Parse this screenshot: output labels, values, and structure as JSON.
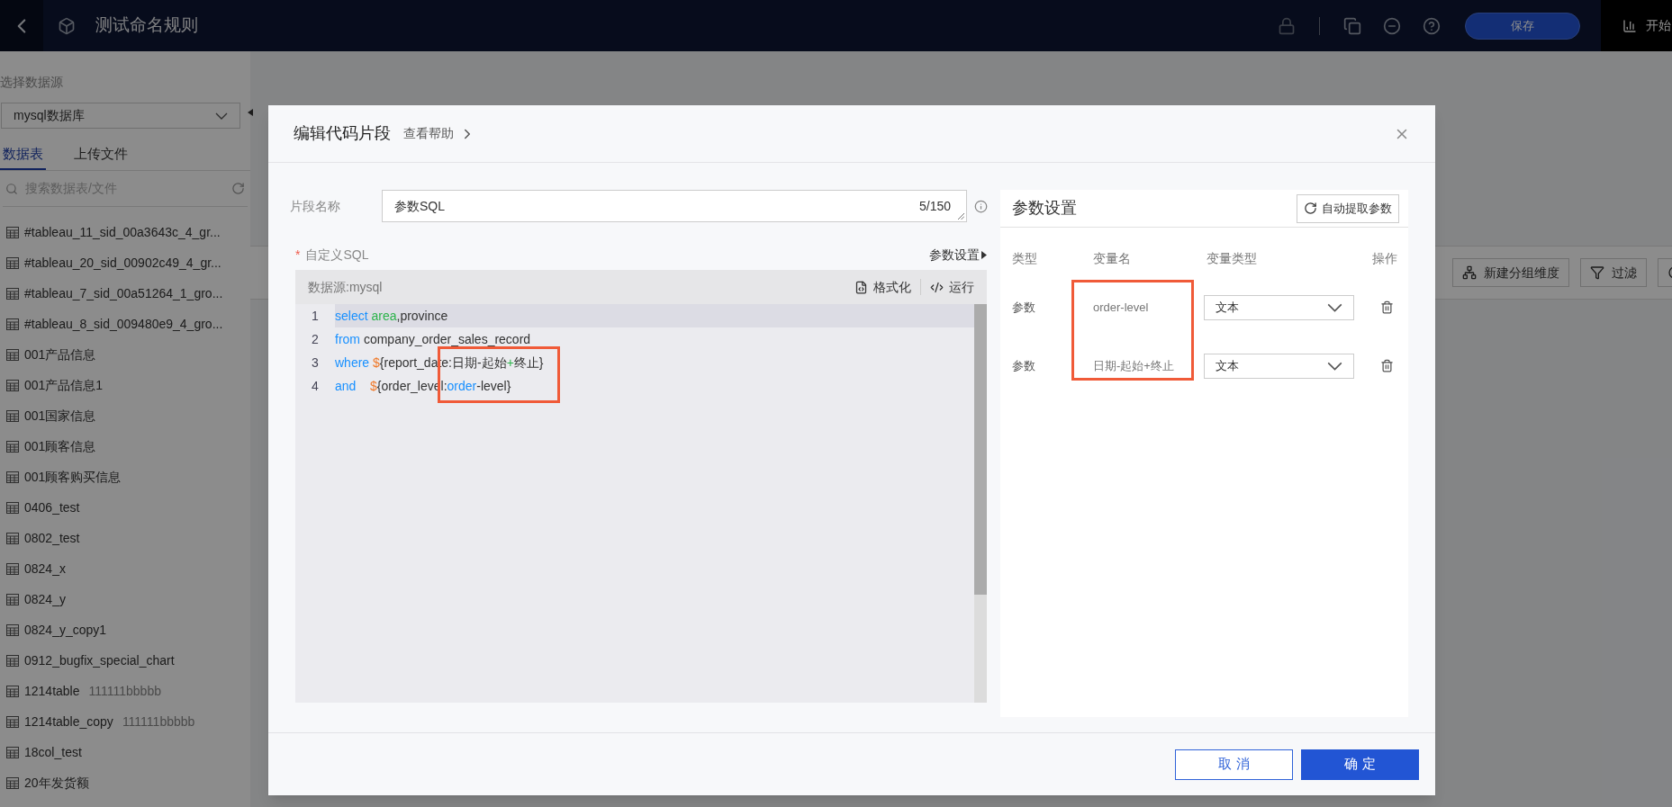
{
  "topbar": {
    "title": "测试命名规则",
    "save_button": "保存",
    "start_label": "开始"
  },
  "sidebar": {
    "source_label": "选择数据源",
    "source_value": "mysql数据库",
    "tabs": [
      {
        "label": "数据表",
        "selected": true
      },
      {
        "label": "上传文件",
        "selected": false
      }
    ],
    "search_placeholder": "搜索数据表/文件",
    "tables": [
      {
        "name": "#tableau_11_sid_00a3643c_4_gr..."
      },
      {
        "name": "#tableau_20_sid_00902c49_4_gr..."
      },
      {
        "name": "#tableau_7_sid_00a51264_1_gro..."
      },
      {
        "name": "#tableau_8_sid_009480e9_4_gro..."
      },
      {
        "name": "001产品信息"
      },
      {
        "name": "001产品信息1"
      },
      {
        "name": "001国家信息"
      },
      {
        "name": "001顾客信息"
      },
      {
        "name": "001顾客购买信息"
      },
      {
        "name": "0406_test"
      },
      {
        "name": "0802_test"
      },
      {
        "name": "0824_x"
      },
      {
        "name": "0824_y"
      },
      {
        "name": "0824_y_copy1"
      },
      {
        "name": "0912_bugfix_special_chart"
      },
      {
        "name": "1214table",
        "note": "111111bbbbb"
      },
      {
        "name": "1214table_copy",
        "note": "111111bbbbb"
      },
      {
        "name": "18col_test"
      },
      {
        "name": "20年发货额"
      }
    ]
  },
  "toolbar": {
    "buttons": [
      {
        "label": "新建分组维度",
        "kind": "group"
      },
      {
        "label": "过滤",
        "kind": "filter"
      },
      {
        "kind": "refresh"
      }
    ]
  },
  "dialog": {
    "title": "编辑代码片段",
    "help_link": "查看帮助",
    "name_field": {
      "label": "片段名称",
      "value": "参数SQL",
      "counter": "5/150"
    },
    "sql": {
      "label": "自定义SQL",
      "required_mark": "*",
      "param_link": "参数设置",
      "source_label": "数据源:mysql",
      "actions": [
        {
          "label": "格式化",
          "kind": "format"
        },
        {
          "label": "运行",
          "kind": "run"
        }
      ],
      "lines": [
        {
          "number": "1",
          "highlighted": true,
          "tokens": [
            {
              "text": "select ",
              "kind": "keyword"
            },
            {
              "text": "area",
              "kind": "field"
            },
            {
              "text": ",province",
              "kind": "plain"
            }
          ]
        },
        {
          "number": "2",
          "highlighted": false,
          "tokens": [
            {
              "text": "from ",
              "kind": "keyword"
            },
            {
              "text": "company_order_sales_record",
              "kind": "plain"
            }
          ]
        },
        {
          "number": "3",
          "highlighted": false,
          "tokens": [
            {
              "text": "where ",
              "kind": "keyword"
            },
            {
              "text": "$",
              "kind": "variable"
            },
            {
              "text": "{report_date:日期-起始",
              "kind": "plain"
            },
            {
              "text": "+",
              "kind": "field"
            },
            {
              "text": "终止}",
              "kind": "plain"
            }
          ]
        },
        {
          "number": "4",
          "highlighted": false,
          "tokens": [
            {
              "text": "and    ",
              "kind": "keyword"
            },
            {
              "text": "$",
              "kind": "variable"
            },
            {
              "text": "{order_level:",
              "kind": "plain"
            },
            {
              "text": "order",
              "kind": "keyword"
            },
            {
              "text": "-level}",
              "kind": "plain"
            }
          ]
        }
      ]
    },
    "params": {
      "title": "参数设置",
      "auto_button": "自动提取参数",
      "columns": [
        "类型",
        "变量名",
        "变量类型",
        "操作"
      ],
      "rows": [
        {
          "type": "参数",
          "name": "order-level",
          "var_type": "文本"
        },
        {
          "type": "参数",
          "name": "日期-起始+终止",
          "var_type": "文本"
        }
      ]
    },
    "buttons": [
      {
        "label": "取 消",
        "kind": "secondary"
      },
      {
        "label": "确 定",
        "kind": "primary"
      }
    ]
  }
}
